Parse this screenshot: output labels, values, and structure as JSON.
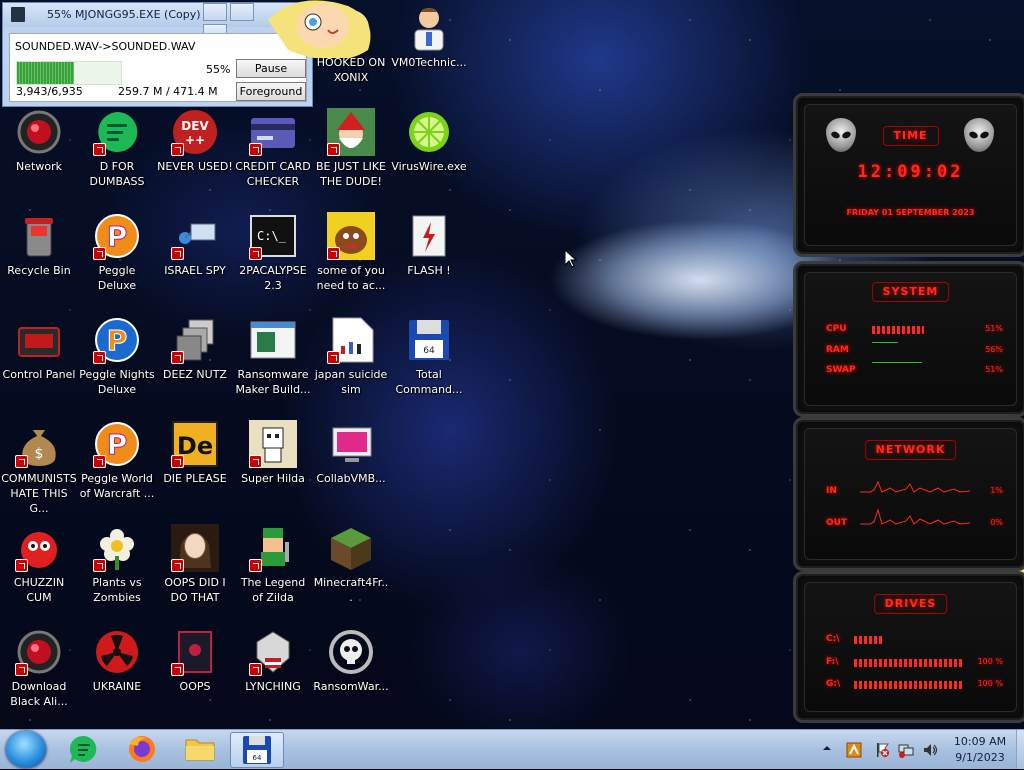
{
  "copy_window": {
    "title": "55% MJONGG95.EXE (Copy)",
    "file": "SOUNDED.WAV->SOUNDED.WAV",
    "percent": "55%",
    "progress_fraction": 0.55,
    "count": "3,943/6,935",
    "size": "259.7 M / 471.4 M",
    "pause_label": "Pause",
    "foreground_label": "Foreground"
  },
  "desktop_icons": [
    {
      "label": "HOOKED ON XONIX",
      "icon": "anime-girl-icon"
    },
    {
      "label": "VM0Technic...",
      "icon": "doctor-icon"
    },
    {
      "label": "Network",
      "icon": "alienware-orb-icon"
    },
    {
      "label": "D FOR DUMBASS",
      "icon": "green-speech-icon"
    },
    {
      "label": "NEVER USED!",
      "icon": "dev-cpp-icon"
    },
    {
      "label": "CREDIT CARD CHECKER",
      "icon": "credit-card-icon"
    },
    {
      "label": "BE JUST LIKE THE DUDE!",
      "icon": "santa-icon"
    },
    {
      "label": "VirusWire.exe",
      "icon": "lime-icon"
    },
    {
      "label": "Recycle Bin",
      "icon": "recycle-bin-icon"
    },
    {
      "label": "Peggle Deluxe",
      "icon": "peggle-icon"
    },
    {
      "label": "ISRAEL SPY",
      "icon": "network-spy-icon"
    },
    {
      "label": "2PACALYPSE 2.3",
      "icon": "terminal-icon"
    },
    {
      "label": "some of you need to ac...",
      "icon": "dog-icon"
    },
    {
      "label": "FLASH !",
      "icon": "flash-icon"
    },
    {
      "label": "Control Panel",
      "icon": "control-panel-icon"
    },
    {
      "label": "Peggle Nights Deluxe",
      "icon": "peggle-nights-icon"
    },
    {
      "label": "DEEZ NUTZ",
      "icon": "windows-stack-icon"
    },
    {
      "label": "Ransomware Maker Build...",
      "icon": "window-app-icon"
    },
    {
      "label": "japan suicide sim",
      "icon": "document-icon"
    },
    {
      "label": "Total Command...",
      "icon": "floppy-icon"
    },
    {
      "label": "COMMUNISTS HATE THIS G...",
      "icon": "money-bag-icon"
    },
    {
      "label": "Peggle World of Warcraft ...",
      "icon": "peggle-wow-icon"
    },
    {
      "label": "DIE PLEASE",
      "icon": "de-icon"
    },
    {
      "label": "Super Hilda",
      "icon": "pixel-character-icon"
    },
    {
      "label": "CollabVMB...",
      "icon": "monitor-icon"
    },
    {
      "label": "CHUZZIN CUM",
      "icon": "chuzzle-icon"
    },
    {
      "label": "Plants vs Zombies",
      "icon": "flower-icon"
    },
    {
      "label": "OOPS DID I DO THAT",
      "icon": "portrait-icon"
    },
    {
      "label": "The Legend of Zilda",
      "icon": "pixel-hero-icon"
    },
    {
      "label": "Minecraft4Fr...",
      "icon": "grass-block-icon"
    },
    {
      "label": "Download Black Ali...",
      "icon": "alienware-orb-icon"
    },
    {
      "label": "UKRAINE",
      "icon": "radiation-icon"
    },
    {
      "label": "OOPS",
      "icon": "dark-window-icon"
    },
    {
      "label": "LYNCHING",
      "icon": "emblem-icon"
    },
    {
      "label": "RansomWar...",
      "icon": "skull-icon"
    }
  ],
  "widget": {
    "time_title": "TIME",
    "time": "12:09:02",
    "date": "FRIDAY 01 SEPTEMBER 2023",
    "system_title": "SYSTEM",
    "cpu_label": "CPU",
    "cpu_value": "51%",
    "ram_label": "RAM",
    "ram_value": "56%",
    "swap_label": "SWAP",
    "swap_value": "51%",
    "network_title": "NETWORK",
    "in_label": "IN",
    "in_value": "1%",
    "out_label": "OUT",
    "out_value": "0%",
    "drives_title": "DRIVES",
    "drives": [
      {
        "label": "C:\\",
        "value": ""
      },
      {
        "label": "F:\\",
        "value": "100 %"
      },
      {
        "label": "G:\\",
        "value": "100 %"
      }
    ]
  },
  "taskbar": {
    "apps": [
      {
        "name": "messages-app",
        "icon": "green-speech-icon"
      },
      {
        "name": "firefox",
        "icon": "firefox-icon"
      },
      {
        "name": "explorer",
        "icon": "folder-icon"
      },
      {
        "name": "total-commander",
        "icon": "floppy-icon"
      }
    ],
    "clock_time": "10:09 AM",
    "clock_date": "9/1/2023"
  },
  "colors": {
    "widget_red": "#ff2a1a",
    "taskbar": "#a9c1e0",
    "progress_green": "#3aa03a"
  }
}
